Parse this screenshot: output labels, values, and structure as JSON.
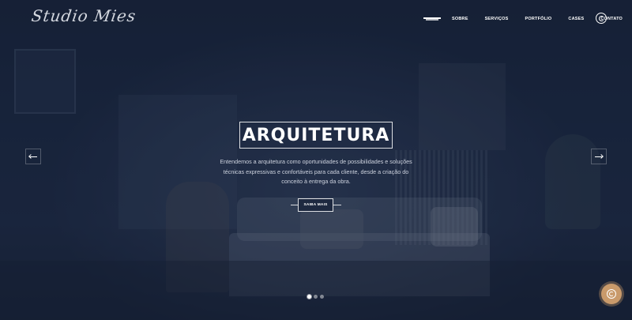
{
  "header": {
    "logo": "Studio Mies",
    "nav": [
      "SOBRE",
      "SERVIÇOS",
      "PORTFÓLIO",
      "CASES",
      "CONTATO"
    ],
    "menu_icon": "hamburger-icon",
    "whatsapp_icon": "whatsapp-icon"
  },
  "hero": {
    "title": "ARQUITETURA",
    "description": "Entendemos a arquitetura como oportunidades de possibilidades e soluções técnicas expressivas e confortáveis para cada cliente, desde a criação do conceito à entrega da obra.",
    "cta": "SAIBA MAIS",
    "prev_icon": "arrow-left-icon",
    "next_icon": "arrow-right-icon",
    "slides": 3,
    "active_slide": 1
  },
  "floating": {
    "whatsapp_icon": "whatsapp-icon",
    "color": "#c99a6b"
  },
  "colors": {
    "background": "#1d2942",
    "text": "#ffffff"
  }
}
